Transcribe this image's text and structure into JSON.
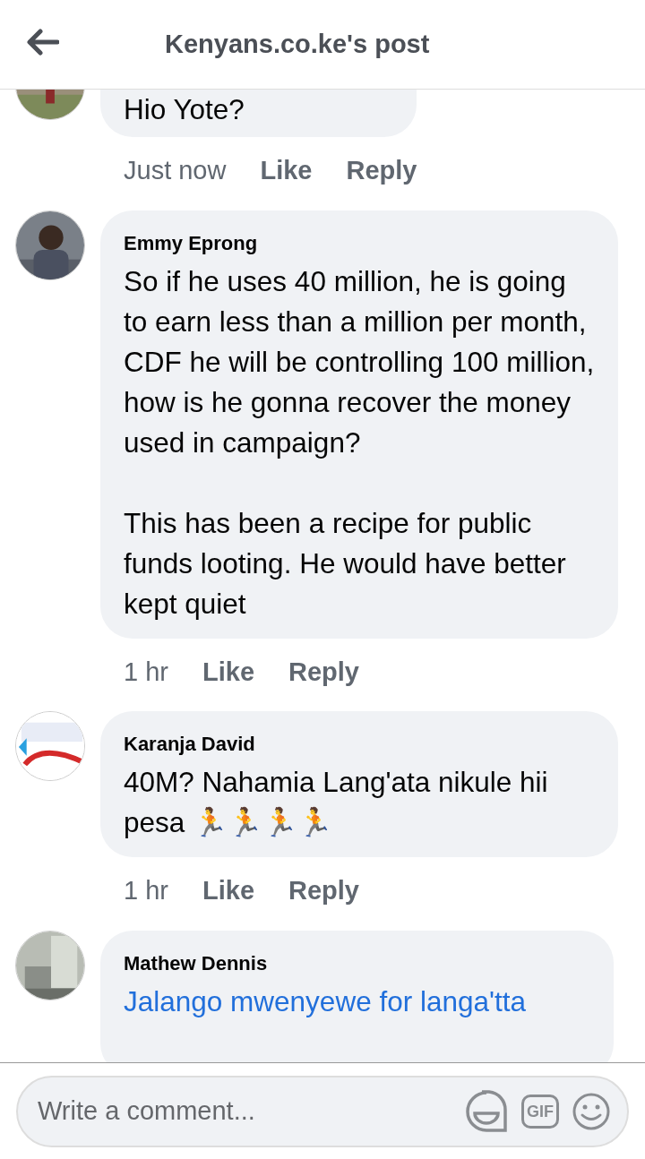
{
  "header": {
    "title": "Kenyans.co.ke's post"
  },
  "comments": [
    {
      "paragraphs": [
        "Hio Yote?"
      ],
      "time": "Just now",
      "actions": [
        "Like",
        "Reply"
      ]
    },
    {
      "author": "Emmy Eprong",
      "paragraphs": [
        "So if he uses 40 million, he is going to earn less than a million per month, CDF he will be controlling 100 million, how is he gonna recover the money used in campaign?",
        "This has been a recipe for public funds looting.  He would have better kept quiet"
      ],
      "time": "1 hr",
      "actions": [
        "Like",
        "Reply"
      ]
    },
    {
      "author": "Karanja David",
      "paragraphs": [
        "40M? Nahamia Lang'ata nikule hii pesa 🏃🏃🏃🏃"
      ],
      "time": "1 hr",
      "actions": [
        "Like",
        "Reply"
      ]
    },
    {
      "author": "Mathew Dennis",
      "link": "Jalango mwenyewe for langa'tta"
    }
  ],
  "composer": {
    "placeholder": "Write a comment...",
    "gif_label": "GIF"
  }
}
